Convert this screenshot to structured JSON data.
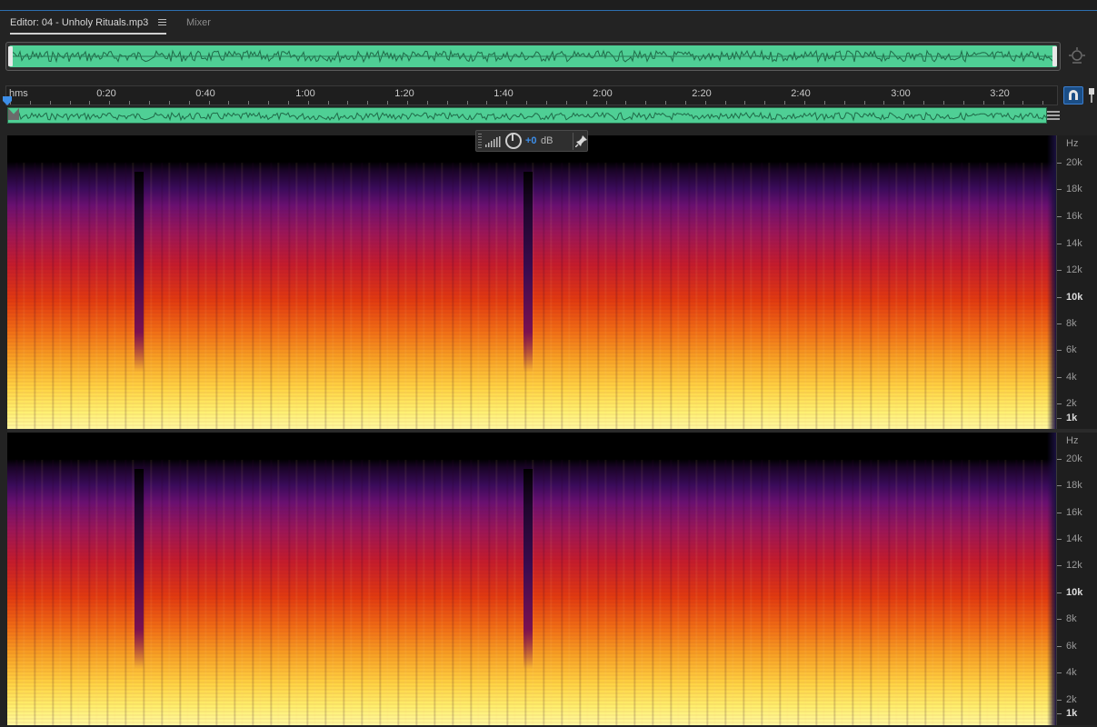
{
  "tabs": {
    "editor_label": "Editor: 04 - Unholy Rituals.mp3",
    "mixer_label": "Mixer"
  },
  "ruler": {
    "unit_label": "hms",
    "time_labels": [
      "0:20",
      "0:40",
      "1:00",
      "1:20",
      "1:40",
      "2:00",
      "2:20",
      "2:40",
      "3:00",
      "3:20"
    ]
  },
  "hud": {
    "gain_value": "+0",
    "gain_unit": "dB"
  },
  "channel_1": {
    "axis_unit": "Hz",
    "freq_labels": [
      "20k",
      "18k",
      "16k",
      "14k",
      "12k",
      "10k",
      "8k",
      "6k",
      "4k",
      "2k",
      "1k"
    ]
  },
  "channel_2": {
    "axis_unit": "Hz",
    "freq_labels": [
      "20k",
      "18k",
      "16k",
      "14k",
      "12k",
      "10k",
      "8k",
      "6k",
      "4k",
      "2k",
      "1k"
    ]
  },
  "colors": {
    "waveform_green": "#4fcf95",
    "accent_blue": "#3d8ee8",
    "background": "#232323"
  },
  "icons": [
    "panel-menu-icon",
    "zoom-navigator-icon",
    "playhead-icon",
    "snap-magnet-icon",
    "marker-pin-icon",
    "signal-bars-icon",
    "volume-knob-icon",
    "pin-icon"
  ]
}
